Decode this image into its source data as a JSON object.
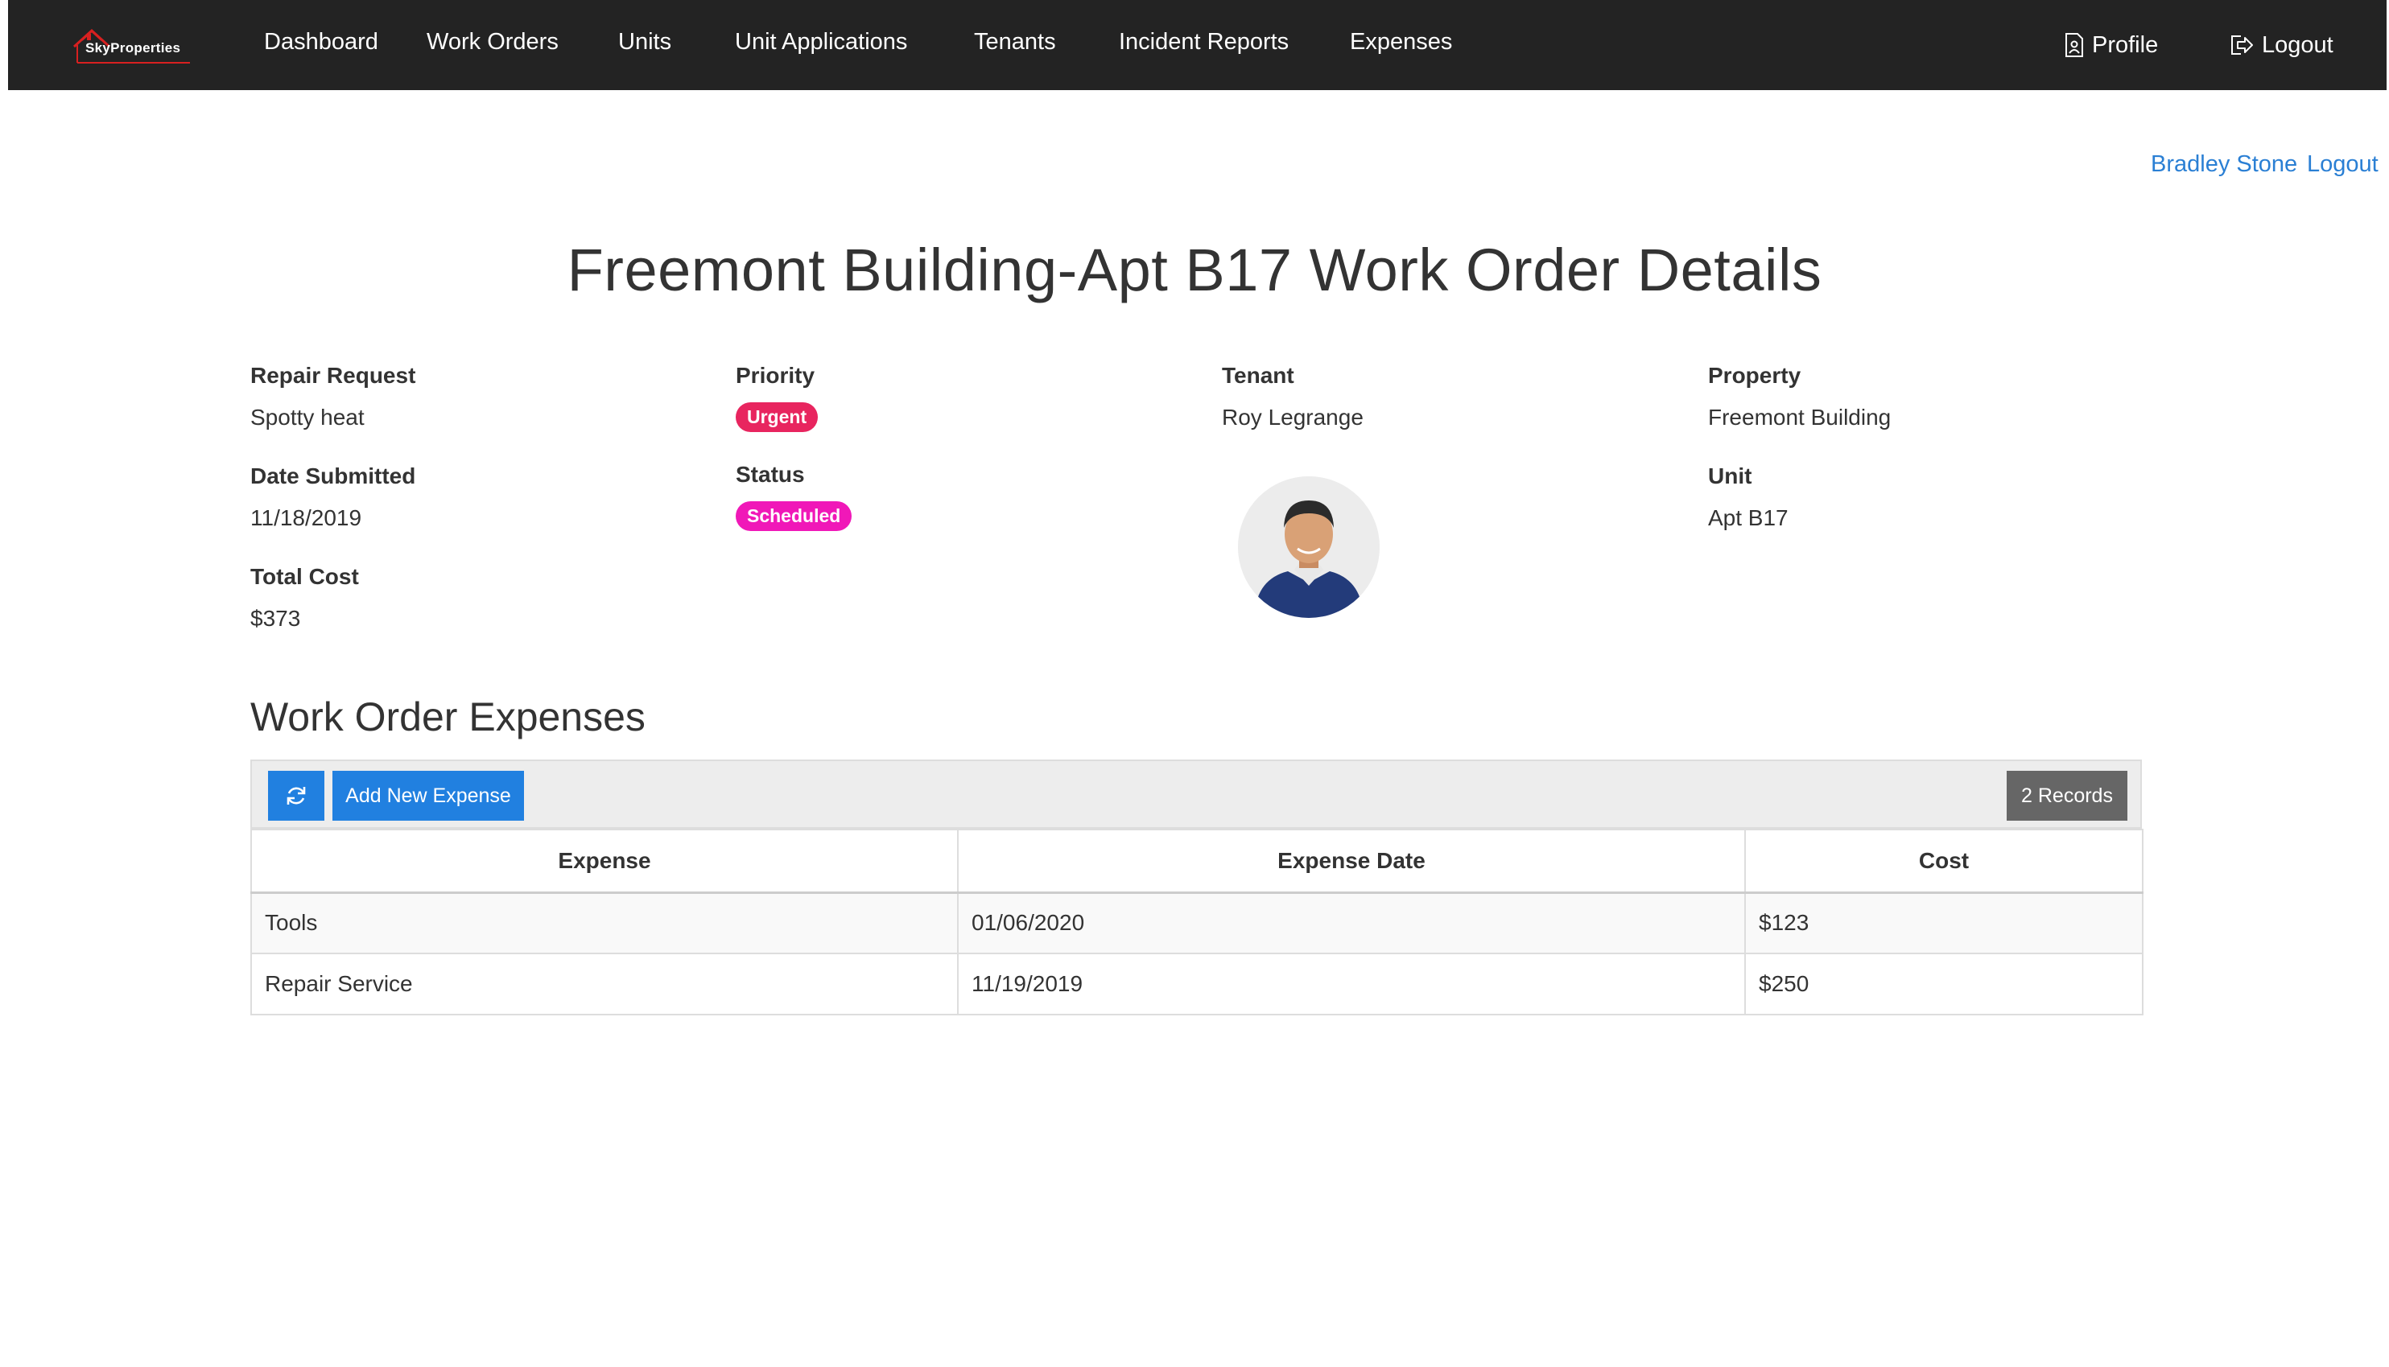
{
  "nav": {
    "brand": "SkyProperties",
    "items": [
      "Dashboard",
      "Work Orders",
      "Units",
      "Unit Applications",
      "Tenants",
      "Incident Reports",
      "Expenses"
    ],
    "profile": "Profile",
    "logout": "Logout"
  },
  "user": {
    "name": "Bradley Stone",
    "logout": "Logout"
  },
  "page": {
    "title": "Freemont Building-Apt B17 Work Order Details"
  },
  "details": {
    "repair_request": {
      "label": "Repair Request",
      "value": "Spotty heat"
    },
    "date_submitted": {
      "label": "Date Submitted",
      "value": "11/18/2019"
    },
    "total_cost": {
      "label": "Total Cost",
      "value": "$373"
    },
    "priority": {
      "label": "Priority",
      "value": "Urgent"
    },
    "status": {
      "label": "Status",
      "value": "Scheduled"
    },
    "tenant": {
      "label": "Tenant",
      "value": "Roy Legrange"
    },
    "property": {
      "label": "Property",
      "value": "Freemont Building"
    },
    "unit": {
      "label": "Unit",
      "value": "Apt B17"
    }
  },
  "expenses": {
    "title": "Work Order Expenses",
    "add_label": "Add New Expense",
    "records_label": "2 Records",
    "columns": [
      "Expense",
      "Expense Date",
      "Cost"
    ],
    "rows": [
      {
        "expense": "Tools",
        "date": "01/06/2020",
        "cost": "$123"
      },
      {
        "expense": "Repair Service",
        "date": "11/19/2019",
        "cost": "$250"
      }
    ]
  },
  "colors": {
    "navbar": "#232323",
    "link": "#2a7fd4",
    "urgent": "#e8255f",
    "scheduled": "#f018b8",
    "primary_button": "#2180e0",
    "records_button": "#666666"
  },
  "icons": {
    "brand": "house-logo-icon",
    "profile": "profile-doc-icon",
    "logout": "logout-icon",
    "refresh": "refresh-icon"
  }
}
